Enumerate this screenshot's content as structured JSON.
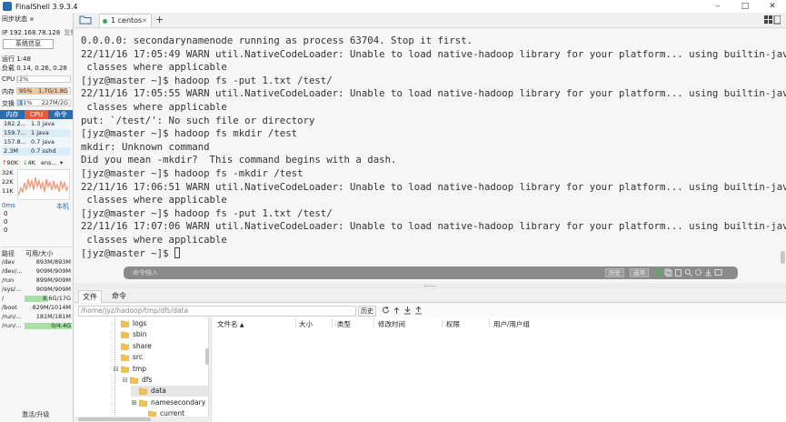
{
  "app": {
    "title": "FinalShell 3.9.3.4"
  },
  "window_controls": {
    "minimize": "–",
    "maximize": "□",
    "close": "✕"
  },
  "left": {
    "sync_status": "同步状态",
    "ip": "IP 192.168.78.128",
    "copy": "复制",
    "sys_info_button": "系统信息",
    "uptime": "运行 1:48",
    "load": "负载 0.14, 0.26, 0.28",
    "cpu": {
      "label": "CPU",
      "value": "2%",
      "percent": 2
    },
    "mem": {
      "label": "内存",
      "percent_text": "95%",
      "value": "1.7G/1.8G",
      "percent": 95
    },
    "swap": {
      "label": "交换",
      "percent_text": "11%",
      "value": "227M/2G",
      "percent": 11
    },
    "proc_tabs": [
      "内存",
      "CPU",
      "命令"
    ],
    "processes": [
      {
        "mem": "182.2...",
        "cpu": "1.3",
        "cmd": "java"
      },
      {
        "mem": "159.7...",
        "cpu": "1",
        "cmd": "java"
      },
      {
        "mem": "157.8...",
        "cpu": "0.7",
        "cmd": "java"
      },
      {
        "mem": "2.3M",
        "cpu": "0.7",
        "cmd": "sshd"
      }
    ],
    "net": {
      "up": "90K",
      "down": "4K",
      "iface": "ens..."
    },
    "graph_labels": [
      "32K",
      "22K",
      "11K"
    ],
    "latency": {
      "value": "0ms",
      "host": "本机"
    },
    "latency_values": [
      "0",
      "0",
      "0"
    ],
    "disk_header": {
      "path": "路径",
      "size": "可用/大小"
    },
    "disks": [
      {
        "path": "/dev",
        "value": "893M/893M",
        "fill": 0
      },
      {
        "path": "/dev/...",
        "value": "909M/909M",
        "fill": 0
      },
      {
        "path": "/run",
        "value": "899M/909M",
        "fill": 0
      },
      {
        "path": "/sys/...",
        "value": "909M/909M",
        "fill": 0
      },
      {
        "path": "/",
        "value": "8.6G/17G",
        "fill": 50
      },
      {
        "path": "/boot",
        "value": "829M/1014M",
        "fill": 0
      },
      {
        "path": "/run/...",
        "value": "181M/181M",
        "fill": 0
      },
      {
        "path": "/run/...",
        "value": "0/4.4G",
        "fill": 100
      }
    ],
    "activate": "激活/升级"
  },
  "tabs": {
    "session": "1 centos",
    "add": "+"
  },
  "terminal": {
    "lines": [
      "0.0.0.0: secondarynamenode running as process 63704. Stop it first.",
      "22/11/16 17:05:49 WARN util.NativeCodeLoader: Unable to load native-hadoop library for your platform... using builtin-java",
      " classes where applicable",
      "[jyz@master ~]$ hadoop fs -put 1.txt /test/",
      "22/11/16 17:05:55 WARN util.NativeCodeLoader: Unable to load native-hadoop library for your platform... using builtin-java",
      " classes where applicable",
      "put: `/test/': No such file or directory",
      "[jyz@master ~]$ hadoop fs mkdir /test",
      "mkdir: Unknown command",
      "Did you mean -mkdir?  This command begins with a dash.",
      "[jyz@master ~]$ hadoop fs -mkdir /test",
      "22/11/16 17:06:51 WARN util.NativeCodeLoader: Unable to load native-hadoop library for your platform... using builtin-java",
      " classes where applicable",
      "[jyz@master ~]$ hadoop fs -put 1.txt /test/",
      "22/11/16 17:07:06 WARN util.NativeCodeLoader: Unable to load native-hadoop library for your platform... using builtin-java",
      " classes where applicable"
    ],
    "prompt": "[jyz@master ~]$ "
  },
  "cmdbar": {
    "placeholder": "命令输入",
    "history": "历史",
    "options": "选项"
  },
  "bottom": {
    "tabs": [
      "文件",
      "命令"
    ],
    "path": "/home/jyz/hadoop/tmp/dfs/data",
    "history_button": "历史",
    "tree": [
      {
        "label": "logs",
        "indent": 0,
        "exp": ""
      },
      {
        "label": "sbin",
        "indent": 0,
        "exp": ""
      },
      {
        "label": "share",
        "indent": 0,
        "exp": ""
      },
      {
        "label": "src",
        "indent": 0,
        "exp": ""
      },
      {
        "label": "tmp",
        "indent": 0,
        "exp": "⊟"
      },
      {
        "label": "dfs",
        "indent": 1,
        "exp": "⊟"
      },
      {
        "label": "data",
        "indent": 2,
        "exp": ""
      },
      {
        "label": "namesecondary",
        "indent": 2,
        "exp": "⊞"
      },
      {
        "label": "current",
        "indent": 3,
        "exp": ""
      }
    ],
    "columns": [
      "文件名",
      "大小",
      "类型",
      "修改时间",
      "权限",
      "用户/用户组"
    ]
  },
  "colors": {
    "accent": "#2b6cb0",
    "mem_fill": "#f0b27a",
    "cpu_tab": "#e25c3c",
    "tab_bg": "#2b6cb0",
    "folder": "#f2c14e"
  }
}
